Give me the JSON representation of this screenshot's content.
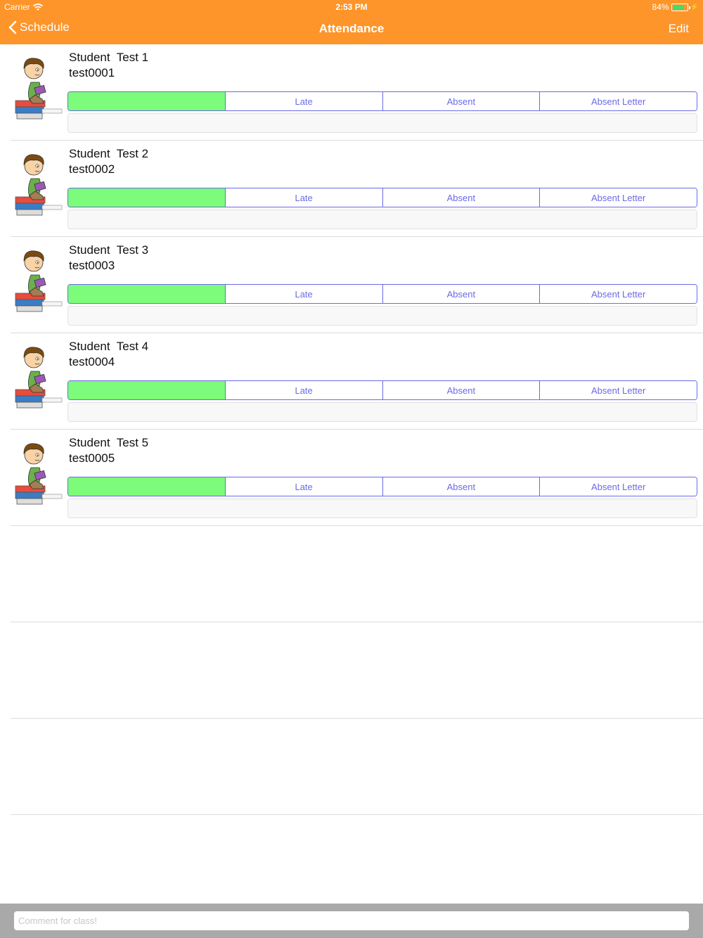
{
  "status_bar": {
    "carrier": "Carrier",
    "time": "2:53 PM",
    "battery": "84%"
  },
  "nav": {
    "back_label": "Schedule",
    "title": "Attendance",
    "edit_label": "Edit"
  },
  "attendance_options": [
    "",
    "Late",
    "Absent",
    "Absent Letter"
  ],
  "students": [
    {
      "name": "Student  Test 1",
      "id": "test0001",
      "selected": 0
    },
    {
      "name": "Student  Test 2",
      "id": "test0002",
      "selected": 0
    },
    {
      "name": "Student  Test 3",
      "id": "test0003",
      "selected": 0
    },
    {
      "name": "Student  Test 4",
      "id": "test0004",
      "selected": 0
    },
    {
      "name": "Student  Test 5",
      "id": "test0005",
      "selected": 0
    }
  ],
  "footer": {
    "comment_placeholder": "Comment for class!"
  },
  "colors": {
    "header": "#FD952A",
    "selected_segment": "#7CFC7A",
    "segment_tint": "#6A6AE8"
  }
}
